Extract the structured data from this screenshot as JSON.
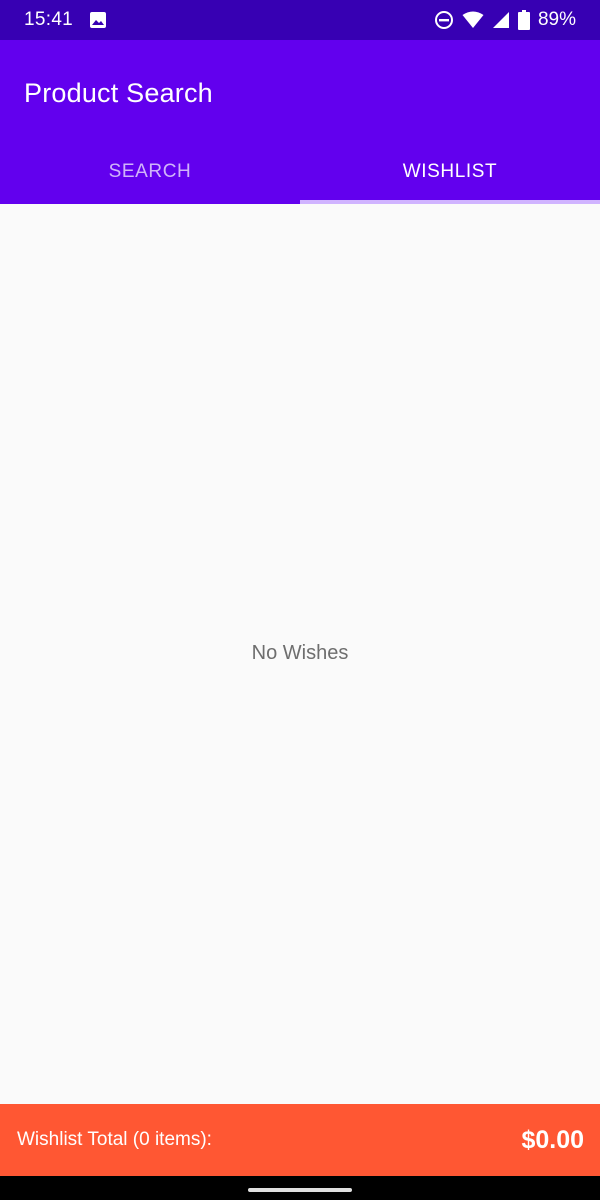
{
  "status_bar": {
    "time": "15:41",
    "battery": "89%",
    "icons": [
      "image-icon",
      "do-not-disturb-icon",
      "wifi-icon",
      "signal-icon",
      "battery-icon"
    ]
  },
  "app_bar": {
    "title": "Product Search",
    "background_color": "#6200ee",
    "tabs": [
      {
        "label": "SEARCH",
        "selected": false
      },
      {
        "label": "WISHLIST",
        "selected": true
      }
    ]
  },
  "content": {
    "empty_message": "No Wishes"
  },
  "footer": {
    "label": "Wishlist Total (0 items):",
    "amount": "$0.00",
    "background_color": "#ff5733"
  }
}
